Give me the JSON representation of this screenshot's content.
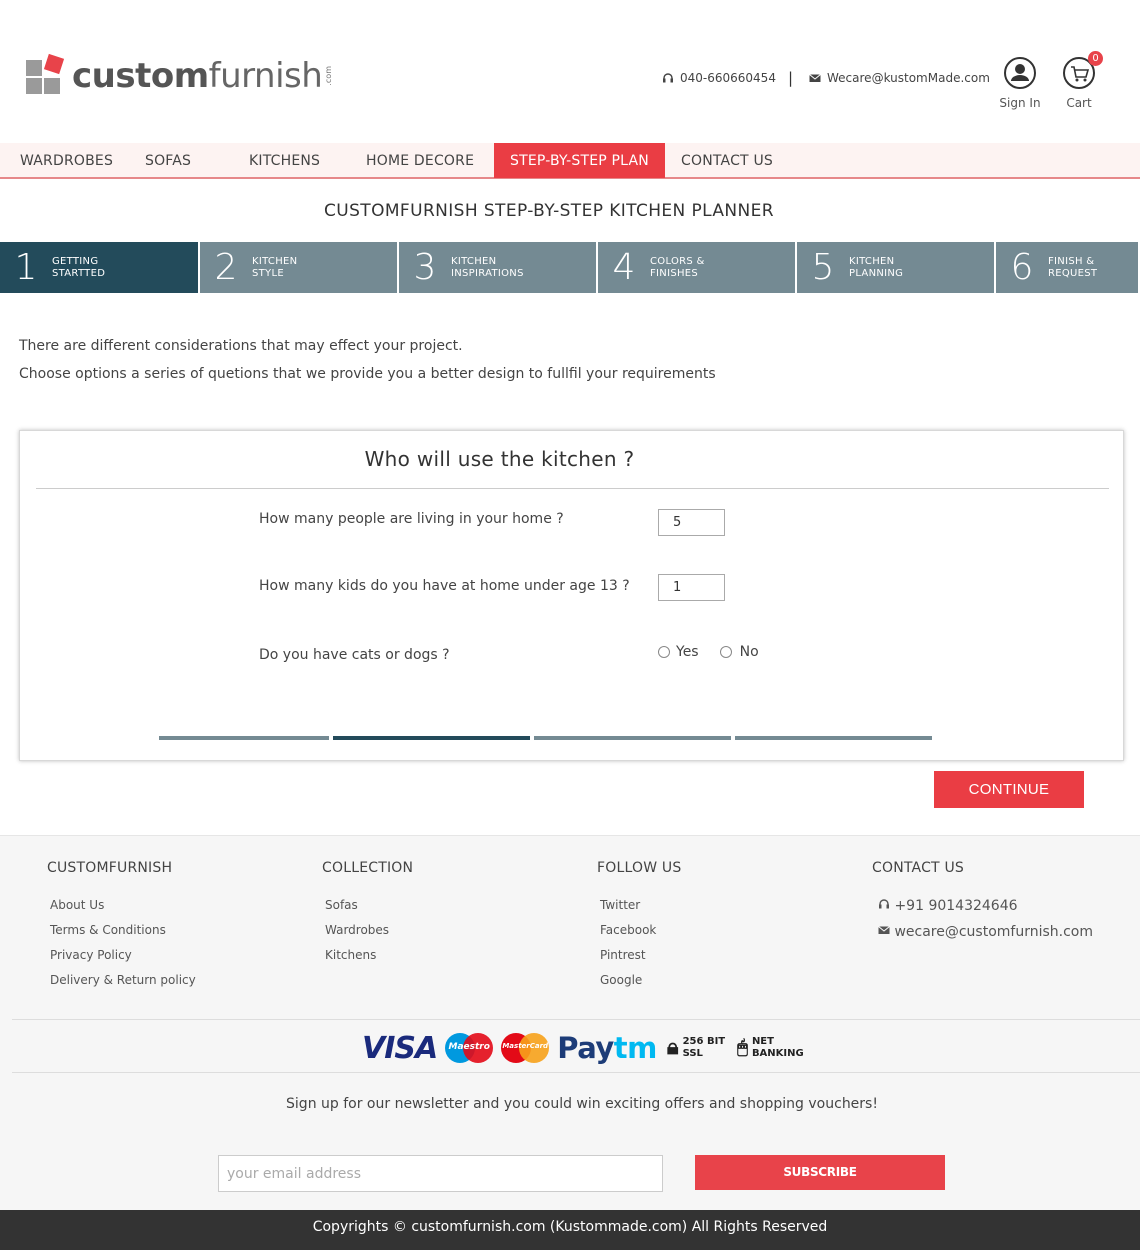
{
  "brand": {
    "name_bold": "custom",
    "name_thin": "furnish",
    "suffix": ".com"
  },
  "header": {
    "phone": "040-660660454",
    "email": "Wecare@kustomMade.com",
    "sign_in": "Sign In",
    "cart": "Cart",
    "cart_count": "0"
  },
  "nav": {
    "items": [
      "WARDROBES",
      "SOFAS",
      "KITCHENS",
      "HOME DECORE",
      "STEP-BY-STEP PLAN",
      "CONTACT US"
    ],
    "active": "STEP-BY-STEP PLAN"
  },
  "planner_title": "CUSTOMFURNISH STEP-BY-STEP KITCHEN PLANNER",
  "steps": [
    {
      "num": "1",
      "line1": "GETTING",
      "line2": "STARTTED"
    },
    {
      "num": "2",
      "line1": "KITCHEN",
      "line2": "STYLE"
    },
    {
      "num": "3",
      "line1": "KITCHEN",
      "line2": "INSPIRATIONS"
    },
    {
      "num": "4",
      "line1": "COLORS &",
      "line2": "FINISHES"
    },
    {
      "num": "5",
      "line1": "KITCHEN",
      "line2": "PLANNING"
    },
    {
      "num": "6",
      "line1": "FINISH &",
      "line2": "REQUEST"
    }
  ],
  "intro": {
    "line1": "There are different considerations that may effect your project.",
    "line2": "Choose options a series of quetions that we provide you a better design to fullfil your requirements"
  },
  "card": {
    "title": "Who will use the kitchen ?",
    "q1": {
      "label": "How many people are living in your home ?",
      "value": "5"
    },
    "q2": {
      "label": "How many kids do you have at home under age 13 ?",
      "value": "1"
    },
    "q3": {
      "label": "Do you have cats or dogs ?",
      "opt_yes": "Yes",
      "opt_no": "No"
    },
    "progress_active_segment": 2,
    "progress_segments": 4
  },
  "continue_label": "CONTINUE",
  "footer": {
    "col1": {
      "heading": "CUSTOMFURNISH",
      "links": [
        "About Us",
        "Terms & Conditions",
        "Privacy Policy",
        "Delivery & Return policy"
      ]
    },
    "col2": {
      "heading": "COLLECTION",
      "links": [
        "Sofas",
        "Wardrobes",
        "Kitchens"
      ]
    },
    "col3": {
      "heading": "FOLLOW US",
      "links": [
        "Twitter",
        "Facebook",
        "Pintrest",
        "Google"
      ]
    },
    "col4": {
      "heading": "CONTACT US",
      "phone": "+91 9014324646",
      "email": "wecare@customfurnish.com"
    },
    "payments": {
      "visa": "VISA",
      "maestro": "Maestro",
      "mastercard": "MasterCard",
      "paytm_a": "Pay",
      "paytm_b": "tm",
      "ssl_1": "256 BIT",
      "ssl_2": "SSL",
      "net_1": "NET",
      "net_2": "BANKING"
    },
    "newsletter": "Sign up for our newsletter and you could win exciting offers and shopping vouchers!",
    "email_placeholder": "your email address",
    "subscribe": "SUBSCRIBE",
    "copyright": "Copyrights © customfurnish.com (Kustommade.com) All Rights Reserved"
  },
  "colors": {
    "accent": "#ea3d44",
    "step_active": "#234b5b",
    "step": "#748a93"
  }
}
